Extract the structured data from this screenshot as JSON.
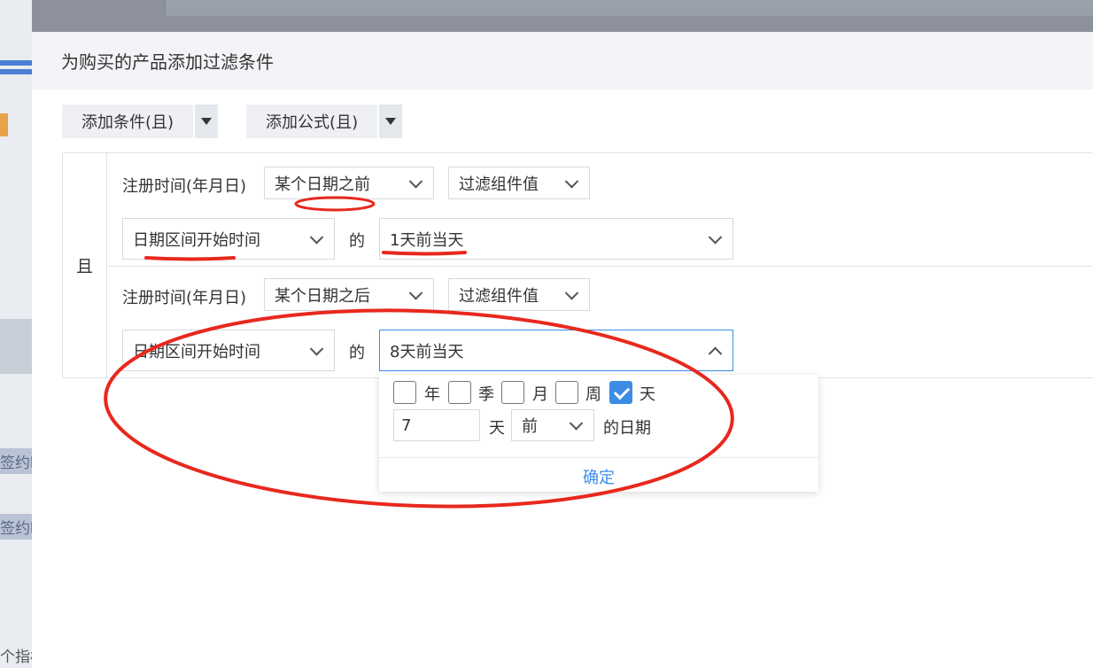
{
  "background": {
    "left_text_1": "签约时",
    "left_text_2": "签约时",
    "left_bottom_text": "个指标"
  },
  "dialog": {
    "title": "为购买的产品添加过滤条件"
  },
  "toolbar": {
    "add_condition": "添加条件(且)",
    "add_formula": "添加公式(且)"
  },
  "conditions": {
    "group_label": "且",
    "rows": [
      {
        "field": "注册时间(年月日)",
        "operator": "某个日期之前",
        "value_type": "过滤组件值",
        "component": "日期区间开始时间",
        "of_label": "的",
        "offset": "1天前当天"
      },
      {
        "field": "注册时间(年月日)",
        "operator": "某个日期之后",
        "value_type": "过滤组件值",
        "component": "日期区间开始时间",
        "of_label": "的",
        "offset": "8天前当天"
      }
    ]
  },
  "popup": {
    "units": [
      {
        "label": "年",
        "checked": false
      },
      {
        "label": "季",
        "checked": false
      },
      {
        "label": "月",
        "checked": false
      },
      {
        "label": "周",
        "checked": false
      },
      {
        "label": "天",
        "checked": true
      }
    ],
    "amount": "7",
    "amount_unit": "天",
    "direction": "前",
    "suffix": "的日期",
    "confirm": "确定"
  },
  "colors": {
    "accent": "#3c8ce6",
    "annotation": "#e8281e"
  }
}
